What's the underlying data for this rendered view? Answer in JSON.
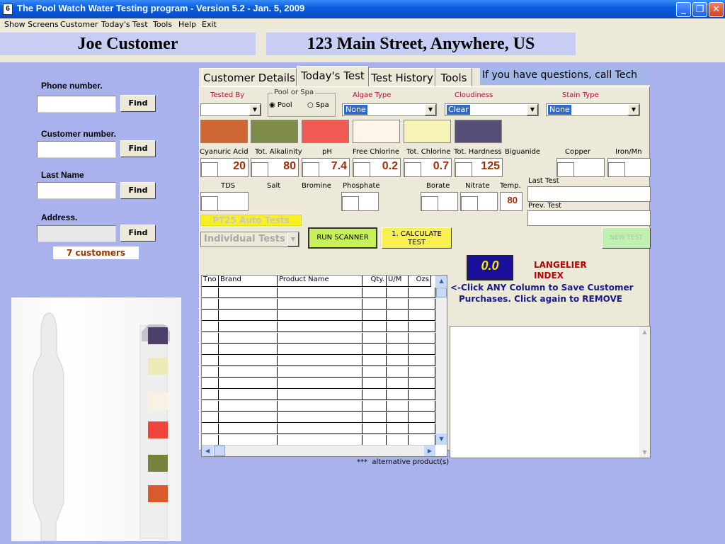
{
  "window": {
    "title": "The Pool Watch Water Testing program - Version 5.2 - Jan. 5, 2009",
    "icon": "app-icon",
    "controls": [
      "minimize",
      "restore",
      "close"
    ]
  },
  "menu": [
    "Show Screens",
    "Customer",
    "Today's Test",
    "Tools",
    "Help",
    "Exit"
  ],
  "header": {
    "customer_name": "Joe Customer",
    "address": "123 Main Street, Anywhere, US"
  },
  "search": {
    "phone_label": "Phone number.",
    "customer_label": "Customer number.",
    "lastname_label": "Last Name",
    "address_label": "Address.",
    "find_label": "Find",
    "count": "7 customers"
  },
  "tabs": {
    "items": [
      "Customer Details",
      "Today's Test",
      "Test History",
      "Tools"
    ],
    "active": "Today's Test",
    "note": "If you have questions, call Tech"
  },
  "test": {
    "tested_by_label": "Tested By",
    "pool_or_spa_label": "Pool or Spa",
    "pool_label": "Pool",
    "spa_label": "Spa",
    "selected": "Pool",
    "algae_label": "Algae Type",
    "algae_value": "None",
    "cloudiness_label": "Cloudiness",
    "cloudiness_value": "Clear",
    "stain_label": "Stain Type",
    "stain_value": "None",
    "swatch_colors": [
      "#cc6633",
      "#808c4c",
      "#f05a52",
      "#fdf5e8",
      "#f6f3b8",
      "#565079"
    ],
    "params": [
      {
        "label": "Cyanuric Acid",
        "value": "20"
      },
      {
        "label": "Tot. Alkalinity",
        "value": "80"
      },
      {
        "label": "pH",
        "value": "7.4"
      },
      {
        "label": "Free Chlorine",
        "value": "0.2"
      },
      {
        "label": "Tot. Chlorine",
        "value": "0.7"
      },
      {
        "label": "Tot. Hardness",
        "value": "125"
      },
      {
        "label": "Biguanide",
        "value": ""
      },
      {
        "label": "Copper",
        "value": ""
      },
      {
        "label": "Iron/Mn",
        "value": ""
      }
    ],
    "params2": {
      "tds": "TDS",
      "salt": "Salt",
      "bromine": "Bromine",
      "phosphate": "Phosphate",
      "borate": "Borate",
      "nitrate": "Nitrate",
      "temp": "Temp.",
      "temp_value": "80"
    },
    "last_test_label": "Last Test",
    "prev_test_label": "Prev. Test",
    "auto_tests_label": "PT25 Auto Tests",
    "individual_tests": "Individual Tests",
    "run_scanner": "RUN SCANNER",
    "calculate_line1": "1.  CALCULATE",
    "calculate_line2": "TEST",
    "new_test": "NEW TEST",
    "lsi_value": "0.0",
    "lsi_label_1": "LANGELIER",
    "lsi_label_2": "INDEX",
    "save_hint_1": "<-Click ANY Column to Save Customer",
    "save_hint_2": "Purchases.  Click again to REMOVE"
  },
  "grid": {
    "headers": [
      "Tno",
      "Brand",
      "Product Name",
      "Qty.",
      "U/M",
      "Ozs"
    ],
    "footer_stars": "***",
    "footer_text": "alternative product(s)"
  },
  "strip": {
    "pad_colors": [
      "#4e3f6a",
      "#ecebb8",
      "#f8f1e4",
      "#f0433a",
      "#77823f",
      "#d95b2a"
    ]
  }
}
